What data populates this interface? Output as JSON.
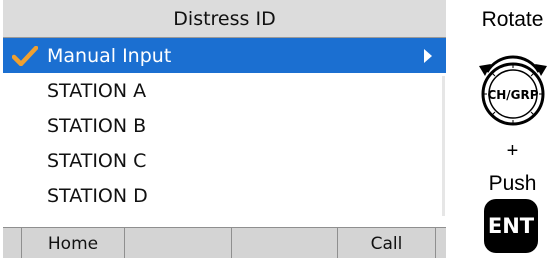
{
  "header": {
    "title": "Distress ID"
  },
  "menu": {
    "items": [
      {
        "label": "Manual Input",
        "selected": true,
        "checked": true,
        "has_submenu": true
      },
      {
        "label": "STATION A"
      },
      {
        "label": "STATION B"
      },
      {
        "label": "STATION C"
      },
      {
        "label": "STATION D"
      }
    ]
  },
  "softkeys": {
    "key1": "Home",
    "key2": "",
    "key3": "",
    "key4": "Call"
  },
  "controls": {
    "rotate_label": "Rotate",
    "knob_label": "CH/GRP",
    "plus": "+",
    "push_label": "Push",
    "ent_label": "ENT"
  },
  "colors": {
    "selection": "#1b6fd1",
    "check": "#f0a030",
    "title_bar": "#dcdcdc",
    "softkey_bar": "#d4d4d4"
  }
}
